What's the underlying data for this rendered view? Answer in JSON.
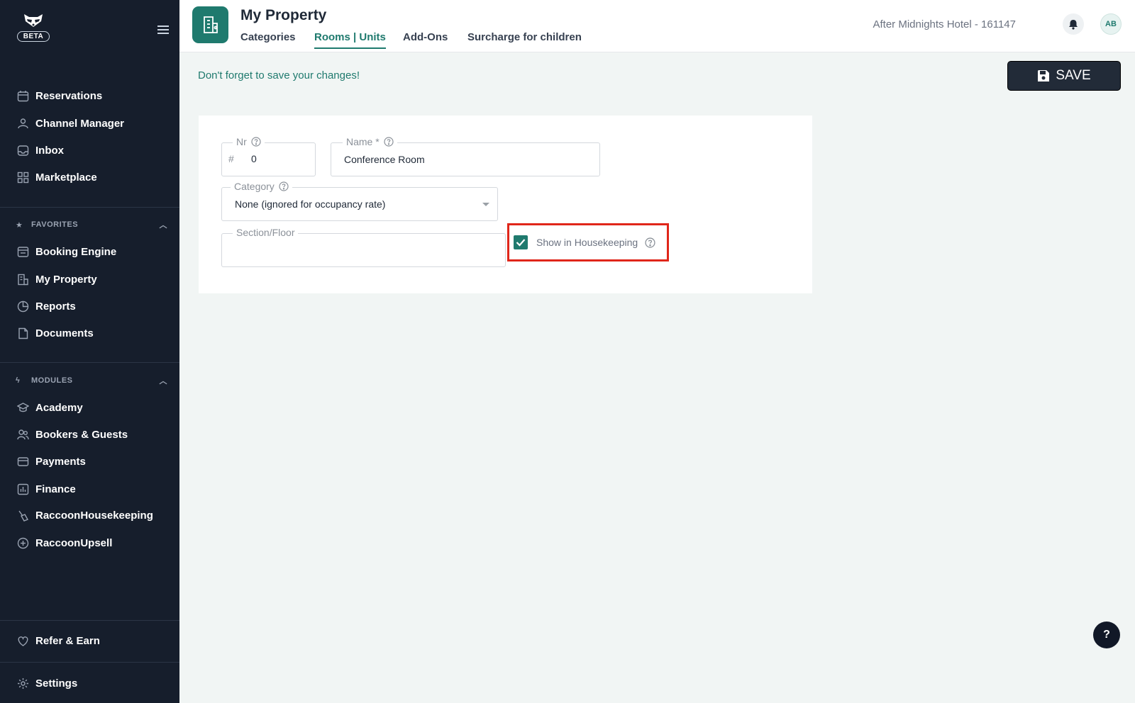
{
  "sidebar": {
    "beta_badge": "BETA",
    "main_items": [
      {
        "label": "Reservations",
        "icon": "calendar-icon"
      },
      {
        "label": "Channel Manager",
        "icon": "channel-icon"
      },
      {
        "label": "Inbox",
        "icon": "inbox-icon"
      },
      {
        "label": "Marketplace",
        "icon": "grid-icon"
      }
    ],
    "favorites": {
      "title": "FAVORITES",
      "items": [
        {
          "label": "Booking Engine",
          "icon": "booking-icon"
        },
        {
          "label": "My Property",
          "icon": "building-icon"
        },
        {
          "label": "Reports",
          "icon": "pie-chart-icon"
        },
        {
          "label": "Documents",
          "icon": "document-icon"
        }
      ]
    },
    "modules": {
      "title": "MODULES",
      "items": [
        {
          "label": "Academy",
          "icon": "academy-icon"
        },
        {
          "label": "Bookers & Guests",
          "icon": "users-icon"
        },
        {
          "label": "Payments",
          "icon": "card-icon"
        },
        {
          "label": "Finance",
          "icon": "finance-icon"
        },
        {
          "label": "RaccoonHousekeeping",
          "icon": "broom-icon"
        },
        {
          "label": "RaccoonUpsell",
          "icon": "plus-circle-icon"
        }
      ]
    },
    "refer": {
      "label": "Refer & Earn",
      "icon": "heart-icon"
    },
    "settings": {
      "label": "Settings",
      "icon": "gear-icon"
    }
  },
  "header": {
    "title": "My Property",
    "tabs": [
      {
        "label": "Categories",
        "active": false
      },
      {
        "label": "Rooms | Units",
        "active": true
      },
      {
        "label": "Add-Ons",
        "active": false
      },
      {
        "label": "Surcharge for children",
        "active": false
      }
    ],
    "hotel": "After Midnights Hotel - 161147",
    "avatar_initials": "AB"
  },
  "content": {
    "save_hint": "Don't forget to save your changes!",
    "save_label": "SAVE",
    "form": {
      "nr": {
        "label": "Nr",
        "prefix": "#",
        "value": "0"
      },
      "name": {
        "label": "Name *",
        "value": "Conference Room"
      },
      "category": {
        "label": "Category",
        "value": "None (ignored for occupancy rate)"
      },
      "section": {
        "label": "Section/Floor",
        "value": ""
      },
      "housekeeping": {
        "label": "Show in Housekeeping",
        "checked": true
      }
    }
  },
  "help_fab": "?",
  "colors": {
    "accent": "#1f7a6e",
    "sidebar_bg": "#161e2c",
    "highlight": "#e0261a"
  }
}
